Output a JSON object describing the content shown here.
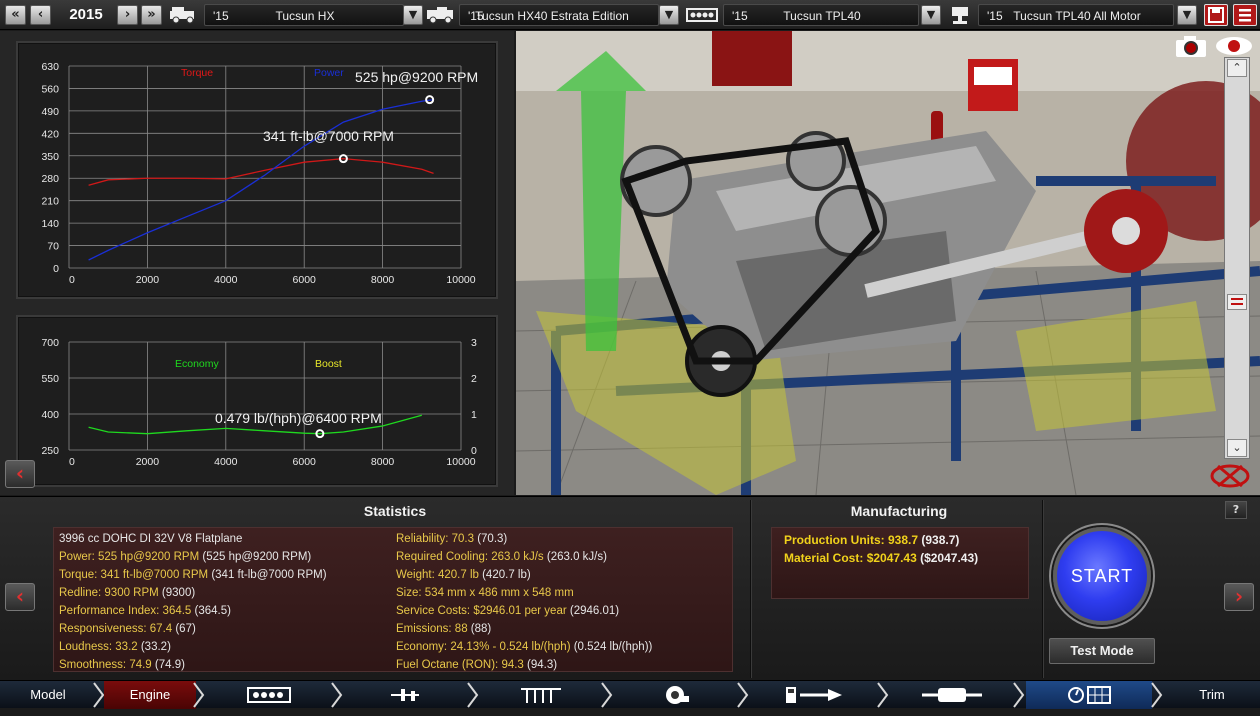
{
  "topbar": {
    "year": "2015",
    "fields": [
      {
        "year": "'15",
        "name": "Tucsun HX"
      },
      {
        "year": "'15",
        "name": "Tucsun HX40 Estrata Edition"
      },
      {
        "year": "'15",
        "name": "Tucsun TPL40"
      },
      {
        "year": "'15",
        "name": "Tucsun TPL40 All Motor"
      }
    ]
  },
  "power_chart": {
    "legend_torque": "Torque",
    "legend_power": "Power",
    "peak_power_label": "525 hp@9200 RPM",
    "peak_torque_label": "341 ft-lb@7000 RPM",
    "y_ticks": [
      "630",
      "560",
      "490",
      "420",
      "350",
      "280",
      "210",
      "140",
      "70",
      "0"
    ],
    "x_ticks": [
      "0",
      "2000",
      "4000",
      "6000",
      "8000",
      "10000"
    ]
  },
  "economy_chart": {
    "legend_economy": "Economy",
    "legend_boost": "Boost",
    "peak_label": "0.479 lb/(hph)@6400 RPM",
    "y_left_ticks": [
      "700",
      "550",
      "400",
      "250"
    ],
    "y_right_ticks": [
      "3",
      "2",
      "1",
      "0"
    ],
    "x_ticks": [
      "0",
      "2000",
      "4000",
      "6000",
      "8000",
      "10000"
    ]
  },
  "chart_data": [
    {
      "type": "line",
      "x": [
        500,
        1000,
        2000,
        3000,
        4000,
        5000,
        6000,
        7000,
        8000,
        9000,
        9300
      ],
      "series": [
        {
          "name": "Torque",
          "color": "#d01818",
          "values": [
            258,
            275,
            280,
            280,
            278,
            305,
            330,
            341,
            330,
            308,
            295
          ]
        },
        {
          "name": "Power",
          "color": "#1a2fd6",
          "values": [
            25,
            55,
            110,
            160,
            210,
            290,
            380,
            455,
            495,
            520,
            525
          ]
        }
      ],
      "xlim": [
        0,
        10000
      ],
      "ylim": [
        0,
        630
      ],
      "grid": true,
      "legend": "top"
    },
    {
      "type": "line",
      "x": [
        500,
        1000,
        2000,
        3000,
        4000,
        5000,
        6000,
        6400,
        7000,
        8000,
        9000
      ],
      "series": [
        {
          "name": "Economy",
          "color": "#1fd91f",
          "values": [
            345,
            325,
            318,
            330,
            340,
            330,
            320,
            318,
            325,
            350,
            395
          ]
        }
      ],
      "xlim": [
        0,
        10000
      ],
      "ylim": [
        250,
        700
      ],
      "grid": true,
      "legend": "top"
    }
  ],
  "statistics": {
    "title": "Statistics",
    "engine_desc": "3996 cc DOHC DI 32V V8 Flatplane",
    "left": [
      {
        "label": "Power:",
        "value": " 525 hp@9200 RPM",
        "extra": " (525 hp@9200 RPM)"
      },
      {
        "label": "Torque:",
        "value": " 341 ft-lb@7000 RPM",
        "extra": " (341 ft-lb@7000 RPM)"
      },
      {
        "label": "Redline:",
        "value": " 9300 RPM",
        "extra": " (9300)"
      },
      {
        "label": "Performance Index:",
        "value": " 364.5",
        "extra": " (364.5)"
      },
      {
        "label": "Responsiveness:",
        "value": " 67.4",
        "extra": " (67)"
      },
      {
        "label": "Loudness:",
        "value": " 33.2",
        "extra": " (33.2)"
      },
      {
        "label": "Smoothness:",
        "value": " 74.9",
        "extra": " (74.9)"
      }
    ],
    "right": [
      {
        "label": "Reliability:",
        "value": " 70.3",
        "extra": " (70.3)"
      },
      {
        "label": "Required Cooling:",
        "value": " 263.0 kJ/s",
        "extra": " (263.0 kJ/s)"
      },
      {
        "label": "Weight:",
        "value": " 420.7 lb",
        "extra": " (420.7 lb)"
      },
      {
        "label": "Size:",
        "value": " 534 mm x 486 mm x 548 mm",
        "extra": ""
      },
      {
        "label": "Service Costs:",
        "value": " $2946.01 per year",
        "extra": " (2946.01)"
      },
      {
        "label": "Emissions:",
        "value": " 88",
        "extra": " (88)"
      },
      {
        "label": "Economy:",
        "value": " 24.13% - 0.524 lb/(hph)",
        "extra": " (0.524 lb/(hph))"
      },
      {
        "label": "Fuel Octane (RON):",
        "value": " 94.3",
        "extra": " (94.3)"
      }
    ]
  },
  "manufacturing": {
    "title": "Manufacturing",
    "production_label": "Production Units:",
    "production_value": " 938.7",
    "production_extra": " (938.7)",
    "material_label": "Material Cost:",
    "material_value": " $2047.43",
    "material_extra": " ($2047.43)"
  },
  "buttons": {
    "start": "START",
    "test_mode": "Test Mode",
    "help": "?"
  },
  "navbar": {
    "model": "Model",
    "engine": "Engine",
    "trim": "Trim"
  }
}
